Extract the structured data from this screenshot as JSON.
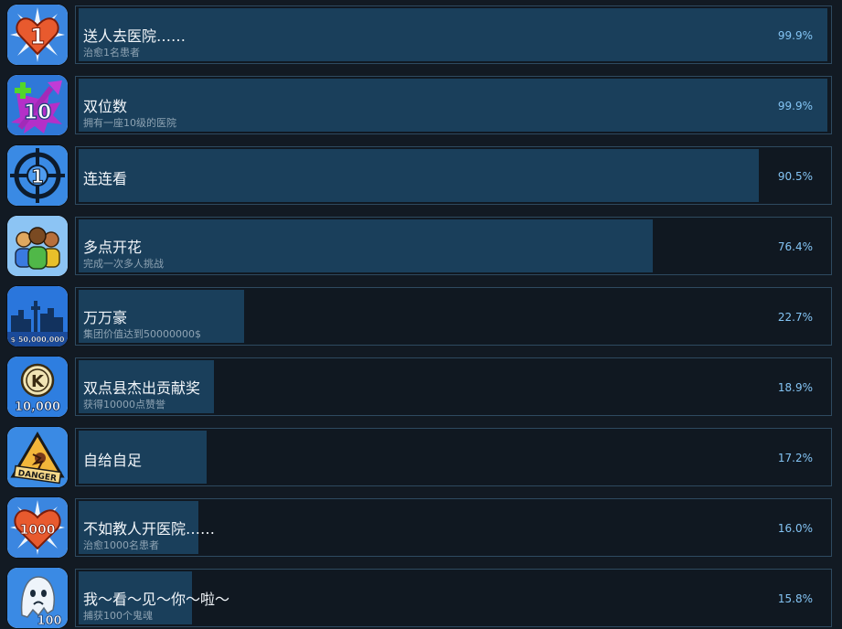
{
  "achievements": [
    {
      "name": "送人去医院……",
      "description": "治愈1名患者",
      "percent_label": "99.9%",
      "percent": 99.9,
      "icon": "heart-one-icon"
    },
    {
      "name": "双位数",
      "description": "拥有一座10级的医院",
      "percent_label": "99.9%",
      "percent": 99.9,
      "icon": "level-ten-icon"
    },
    {
      "name": "连连看",
      "description": "",
      "percent_label": "90.5%",
      "percent": 90.5,
      "icon": "crosshair-icon"
    },
    {
      "name": "多点开花",
      "description": "完成一次多人挑战",
      "percent_label": "76.4%",
      "percent": 76.4,
      "icon": "multiplayer-people-icon"
    },
    {
      "name": "万万豪",
      "description": "集团价值达到50000000$",
      "percent_label": "22.7%",
      "percent": 22.7,
      "icon": "city-skyline-icon",
      "icon_text": "$ 50,000,000"
    },
    {
      "name": "双点县杰出贡献奖",
      "description": "获得10000点赞誉",
      "percent_label": "18.9%",
      "percent": 18.9,
      "icon": "kudosh-coin-icon",
      "icon_text": "10,000"
    },
    {
      "name": "自给自足",
      "description": "",
      "percent_label": "17.2%",
      "percent": 17.2,
      "icon": "danger-sign-icon",
      "icon_text": "DANGER"
    },
    {
      "name": "不如教人开医院……",
      "description": "治愈1000名患者",
      "percent_label": "16.0%",
      "percent": 16.0,
      "icon": "heart-thousand-icon",
      "icon_text": "1000"
    },
    {
      "name": "我～看～见～你～啦～",
      "description": "捕获100个鬼魂",
      "percent_label": "15.8%",
      "percent": 15.8,
      "icon": "ghost-icon",
      "icon_text": "100"
    }
  ],
  "colors": {
    "background": "#121a23",
    "progress_fill": "#1a3f5b",
    "panel_border": "#2e4a60",
    "percent_text": "#84c4f4"
  }
}
